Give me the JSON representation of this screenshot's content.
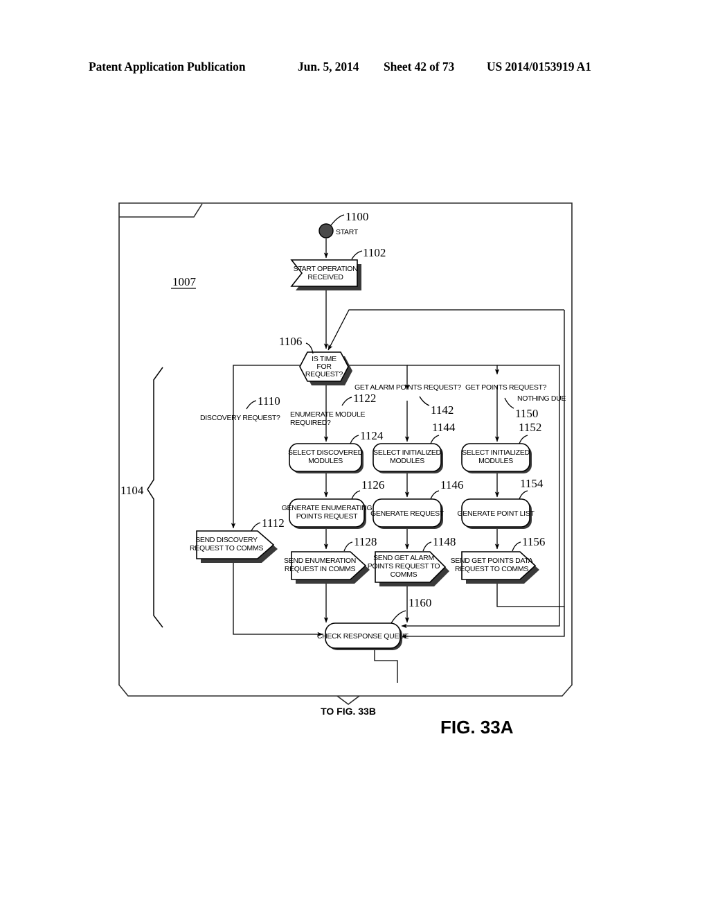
{
  "header": {
    "publication": "Patent Application Publication",
    "date": "Jun. 5, 2014",
    "sheet": "Sheet 42 of 73",
    "number": "US 2014/0153919 A1"
  },
  "figure": {
    "label": "FIG. 33A",
    "continuation": "TO FIG. 33B",
    "frame_ref": "1007",
    "brace_ref": "1104"
  },
  "nodes": {
    "start": {
      "label": "START",
      "ref": "1100"
    },
    "start_operation_received": {
      "label_line1": "START OPERATION",
      "label_line2": "RECEIVED",
      "ref": "1102"
    },
    "is_time_for_request": {
      "label_line1": "IS TIME",
      "label_line2": "FOR",
      "label_line3": "REQUEST?",
      "ref": "1106"
    },
    "send_discovery_request": {
      "label_line1": "SEND DISCOVERY",
      "label_line2": "REQUEST TO COMMS",
      "ref": "1112"
    },
    "select_discovered_modules": {
      "label_line1": "SELECT DISCOVERED",
      "label_line2": "MODULES",
      "ref": "1124"
    },
    "generate_enumerating_points_request": {
      "label_line1": "GENERATE ENUMERATING",
      "label_line2": "POINTS REQUEST",
      "ref": "1126"
    },
    "send_enumeration_request": {
      "label_line1": "SEND ENUMERATION",
      "label_line2": "REQUEST IN COMMS",
      "ref": "1128"
    },
    "select_initialized_modules_alarm": {
      "label_line1": "SELECT INITIALIZED",
      "label_line2": "MODULES",
      "ref": "1144"
    },
    "generate_request": {
      "label_line1": "GENERATE REQUEST",
      "label_line2": "",
      "ref": "1146"
    },
    "send_get_alarm_points_request": {
      "label_line1": "SEND GET ALARM",
      "label_line2": "POINTS REQUEST TO",
      "label_line3": "COMMS",
      "ref": "1148"
    },
    "select_initialized_modules_points": {
      "label_line1": "SELECT INITIALIZED",
      "label_line2": "MODULES",
      "ref": "1152"
    },
    "generate_point_list": {
      "label_line1": "GENERATE POINT LIST",
      "label_line2": "",
      "ref": "1154"
    },
    "send_get_points_data_request": {
      "label_line1": "SEND GET POINTS DATA",
      "label_line2": "REQUEST TO COMMS",
      "ref": "1156"
    },
    "check_response_queue": {
      "label_line1": "CHECK RESPONSE QUEUE",
      "ref": "1160"
    }
  },
  "branch_labels": {
    "discovery_request": {
      "text": "DISCOVERY REQUEST?",
      "ref": "1110"
    },
    "enumerate_module_required": {
      "text_line1": "ENUMERATE MODULE",
      "text_line2": "REQUIRED?",
      "ref": "1122"
    },
    "get_alarm_points_request": {
      "text": "GET ALARM POINTS REQUEST?",
      "ref": "1142"
    },
    "get_points_request": {
      "text": "GET POINTS REQUEST?",
      "ref": "1150"
    },
    "nothing_due": {
      "text": "NOTHING DUE",
      "ref": ""
    }
  },
  "colors": {
    "ink": "#000000",
    "frame": "#2b2b2b",
    "shadow": "#3a3a3a",
    "paper": "#ffffff"
  }
}
